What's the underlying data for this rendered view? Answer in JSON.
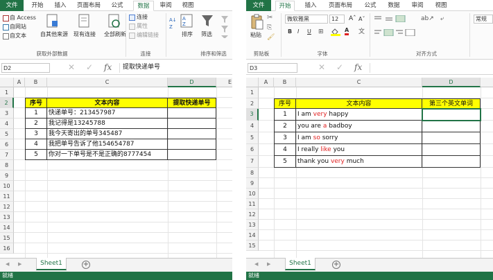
{
  "left": {
    "tabs": [
      "文件",
      "开始",
      "插入",
      "页面布局",
      "公式",
      "数据",
      "审阅",
      "视图"
    ],
    "active_tab": "数据",
    "ribbon": {
      "access": "自 Access",
      "website": "自网站",
      "text": "自文本",
      "other_sources": "自其他来源",
      "existing": "现有连接",
      "refresh_all": "全部刷新",
      "connections": "连接",
      "properties": "属性",
      "edit_links": "编辑链接",
      "sort": "排序",
      "filter": "筛选",
      "group_external": "获取外部数据",
      "group_conn": "连接",
      "group_sort": "排序和筛选"
    },
    "name_box": "D2",
    "formula": "提取快递单号",
    "columns": [
      "A",
      "B",
      "C",
      "D",
      "E"
    ],
    "rows": [
      "1",
      "2",
      "3",
      "4",
      "5",
      "6",
      "7",
      "8",
      "9",
      "10",
      "11",
      "12",
      "13",
      "14",
      "15",
      "16"
    ],
    "table": {
      "headers": [
        "序号",
        "文本内容",
        "提取快递单号"
      ],
      "rows": [
        {
          "n": "1",
          "text": "快递单号：213457987"
        },
        {
          "n": "2",
          "text": "我记得是13245788"
        },
        {
          "n": "3",
          "text": "我今天寄出的单号345487"
        },
        {
          "n": "4",
          "text": "我把单号告诉了他154654787"
        },
        {
          "n": "5",
          "text": "你对一下单号是不是正确的8777454"
        }
      ]
    },
    "sheet": "Sheet1",
    "status": "就绪"
  },
  "right": {
    "tabs": [
      "文件",
      "开始",
      "插入",
      "页面布局",
      "公式",
      "数据",
      "审阅",
      "视图"
    ],
    "active_tab": "开始",
    "ribbon": {
      "paste": "粘贴",
      "font_name": "微软雅黑",
      "font_size": "12",
      "bold": "B",
      "italic": "I",
      "underline": "U",
      "font_color": "A",
      "wrap": "常规",
      "group_clipboard": "剪贴板",
      "group_font": "字体",
      "group_align": "对齐方式"
    },
    "name_box": "D3",
    "formula": "",
    "columns": [
      "A",
      "B",
      "C",
      "D"
    ],
    "rows": [
      "1",
      "2",
      "3",
      "4",
      "5",
      "6",
      "7",
      "8",
      "9",
      "10",
      "11",
      "12",
      "13",
      "14",
      "15"
    ],
    "table": {
      "headers": [
        "序号",
        "文本内容",
        "第三个英文单词"
      ],
      "rows": [
        {
          "n": "1",
          "pre": "I am ",
          "red": "very",
          "post": " happy"
        },
        {
          "n": "2",
          "pre": "you are ",
          "red": "a",
          "post": " badboy"
        },
        {
          "n": "3",
          "pre": "I am ",
          "red": "so",
          "post": "  sorry"
        },
        {
          "n": "4",
          "pre": "I really ",
          "red": "like",
          "post": " you"
        },
        {
          "n": "5",
          "pre": "thank you ",
          "red": "very",
          "post": " much"
        }
      ]
    },
    "sheet": "Sheet1",
    "status": "就绪"
  },
  "colors": {
    "excel_green": "#217346",
    "header_fill": "#ffff00",
    "highlight_text": "#e02020"
  }
}
